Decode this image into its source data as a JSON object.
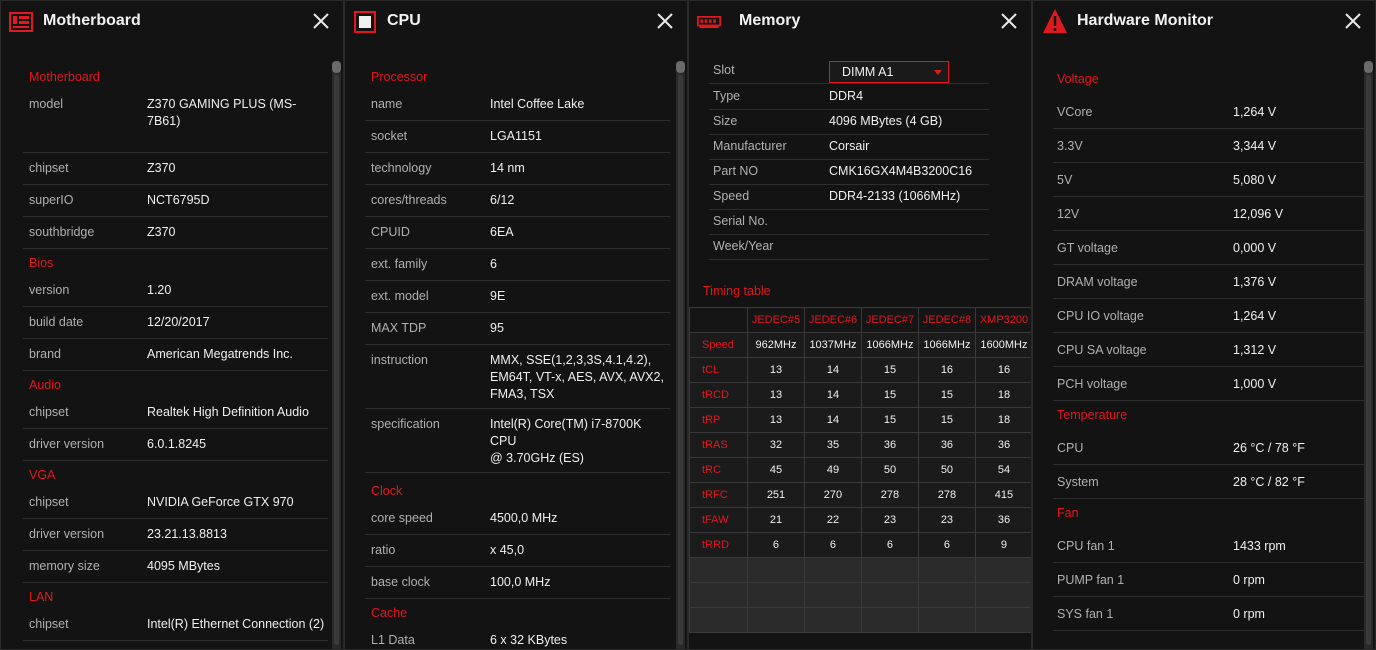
{
  "motherboard": {
    "title": "Motherboard",
    "sections": [
      {
        "name": "Motherboard",
        "rows": [
          {
            "k": "model",
            "v": "Z370 GAMING PLUS (MS-7B61)"
          },
          {
            "k": "chipset",
            "v": "Z370"
          },
          {
            "k": "superIO",
            "v": "NCT6795D"
          },
          {
            "k": "southbridge",
            "v": "Z370"
          }
        ]
      },
      {
        "name": "Bios",
        "rows": [
          {
            "k": "version",
            "v": "1.20"
          },
          {
            "k": "build date",
            "v": "12/20/2017"
          },
          {
            "k": "brand",
            "v": "American Megatrends Inc."
          }
        ]
      },
      {
        "name": "Audio",
        "rows": [
          {
            "k": "chipset",
            "v": "Realtek High Definition Audio"
          },
          {
            "k": "driver version",
            "v": "6.0.1.8245"
          }
        ]
      },
      {
        "name": "VGA",
        "rows": [
          {
            "k": "chipset",
            "v": "NVIDIA GeForce GTX 970"
          },
          {
            "k": "driver version",
            "v": "23.21.13.8813"
          },
          {
            "k": "memory size",
            "v": "4095 MBytes"
          }
        ]
      },
      {
        "name": "LAN",
        "rows": [
          {
            "k": "chipset",
            "v": "Intel(R) Ethernet Connection (2)"
          }
        ]
      }
    ]
  },
  "cpu": {
    "title": "CPU",
    "sections": [
      {
        "name": "Processor",
        "rows": [
          {
            "k": "name",
            "v": "Intel Coffee Lake"
          },
          {
            "k": "socket",
            "v": "LGA1151"
          },
          {
            "k": "technology",
            "v": "14 nm"
          },
          {
            "k": "cores/threads",
            "v": "6/12"
          },
          {
            "k": "CPUID",
            "v": "6EA"
          },
          {
            "k": "ext. family",
            "v": "6"
          },
          {
            "k": "ext. model",
            "v": "9E"
          },
          {
            "k": "MAX TDP",
            "v": "95"
          },
          {
            "k": "instruction",
            "v": "MMX, SSE(1,2,3,3S,4.1,4.2),\nEM64T, VT-x, AES, AVX, AVX2,\nFMA3, TSX"
          },
          {
            "k": "specification",
            "v": "Intel(R) Core(TM) i7-8700K CPU\n@ 3.70GHz (ES)"
          }
        ]
      },
      {
        "name": "Clock",
        "rows": [
          {
            "k": "core speed",
            "v": "4500,0 MHz"
          },
          {
            "k": "ratio",
            "v": "x 45,0"
          },
          {
            "k": "base clock",
            "v": "100,0 MHz"
          }
        ]
      },
      {
        "name": "Cache",
        "rows": [
          {
            "k": "L1 Data",
            "v": "6 x 32 KBytes"
          }
        ]
      }
    ]
  },
  "memory": {
    "title": "Memory",
    "slot_label": "Slot",
    "slot_value": "DIMM A1",
    "rows": [
      {
        "k": "Type",
        "v": "DDR4"
      },
      {
        "k": "Size",
        "v": "4096 MBytes (4 GB)"
      },
      {
        "k": "Manufacturer",
        "v": "Corsair"
      },
      {
        "k": "Part NO",
        "v": "CMK16GX4M4B3200C16"
      },
      {
        "k": "Speed",
        "v": "DDR4-2133 (1066MHz)"
      },
      {
        "k": "Serial No.",
        "v": ""
      },
      {
        "k": "Week/Year",
        "v": ""
      }
    ],
    "timing_title": "Timing table",
    "timing_headers": [
      "JEDEC#5",
      "JEDEC#6",
      "JEDEC#7",
      "JEDEC#8",
      "XMP3200"
    ],
    "timing_rows": [
      {
        "label": "Speed",
        "values": [
          "962MHz",
          "1037MHz",
          "1066MHz",
          "1066MHz",
          "1600MHz"
        ]
      },
      {
        "label": "tCL",
        "values": [
          "13",
          "14",
          "15",
          "16",
          "16"
        ]
      },
      {
        "label": "tRCD",
        "values": [
          "13",
          "14",
          "15",
          "15",
          "18"
        ]
      },
      {
        "label": "tRP",
        "values": [
          "13",
          "14",
          "15",
          "15",
          "18"
        ]
      },
      {
        "label": "tRAS",
        "values": [
          "32",
          "35",
          "36",
          "36",
          "36"
        ]
      },
      {
        "label": "tRC",
        "values": [
          "45",
          "49",
          "50",
          "50",
          "54"
        ]
      },
      {
        "label": "tRFC",
        "values": [
          "251",
          "270",
          "278",
          "278",
          "415"
        ]
      },
      {
        "label": "tFAW",
        "values": [
          "21",
          "22",
          "23",
          "23",
          "36"
        ]
      },
      {
        "label": "tRRD",
        "values": [
          "6",
          "6",
          "6",
          "6",
          "9"
        ]
      }
    ]
  },
  "hwmonitor": {
    "title": "Hardware Monitor",
    "sections": [
      {
        "name": "Voltage",
        "rows": [
          {
            "k": "VCore",
            "v": "1,264 V"
          },
          {
            "k": "3.3V",
            "v": "3,344 V"
          },
          {
            "k": "5V",
            "v": "5,080 V"
          },
          {
            "k": "12V",
            "v": "12,096 V"
          },
          {
            "k": "GT voltage",
            "v": "0,000 V"
          },
          {
            "k": "DRAM voltage",
            "v": "1,376 V"
          },
          {
            "k": "CPU IO voltage",
            "v": "1,264 V"
          },
          {
            "k": "CPU SA voltage",
            "v": "1,312 V"
          },
          {
            "k": "PCH voltage",
            "v": "1,000 V"
          }
        ]
      },
      {
        "name": "Temperature",
        "rows": [
          {
            "k": "CPU",
            "v": "26 °C / 78 °F"
          },
          {
            "k": "System",
            "v": "28 °C / 82 °F"
          }
        ]
      },
      {
        "name": "Fan",
        "rows": [
          {
            "k": "CPU fan 1",
            "v": "1433 rpm"
          },
          {
            "k": "PUMP fan 1",
            "v": "0 rpm"
          },
          {
            "k": "SYS fan 1",
            "v": "0 rpm"
          }
        ]
      }
    ]
  }
}
